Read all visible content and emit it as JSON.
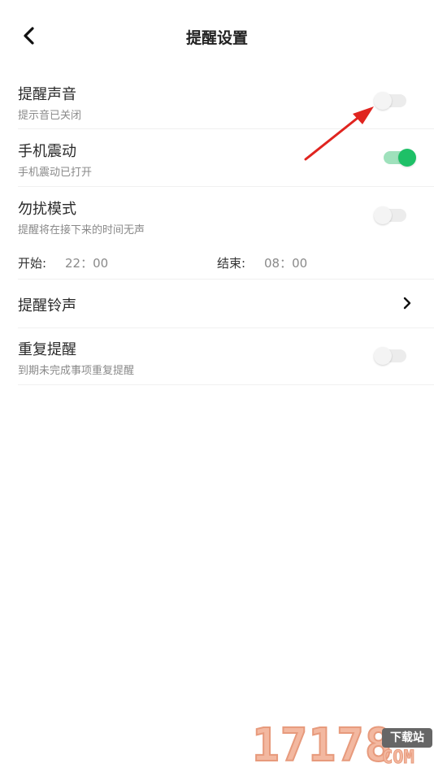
{
  "header": {
    "title": "提醒设置"
  },
  "settings": {
    "sound": {
      "title": "提醒声音",
      "subtitle": "提示音已关闭",
      "enabled": false
    },
    "vibrate": {
      "title": "手机震动",
      "subtitle": "手机震动已打开",
      "enabled": true
    },
    "dnd": {
      "title": "勿扰模式",
      "subtitle": "提醒将在接下来的时间无声",
      "enabled": false,
      "start_label": "开始:",
      "start_time": "22：00",
      "end_label": "结束:",
      "end_time": "08：00"
    },
    "ringtone": {
      "title": "提醒铃声"
    },
    "repeat": {
      "title": "重复提醒",
      "subtitle": "到期未完成事项重复提醒",
      "enabled": false
    }
  },
  "colors": {
    "accent_green": "#1ec067",
    "annotation_red": "#e0241f"
  },
  "watermark": {
    "digits": "17178",
    "badge": "下载站",
    "suffix": "COM"
  }
}
